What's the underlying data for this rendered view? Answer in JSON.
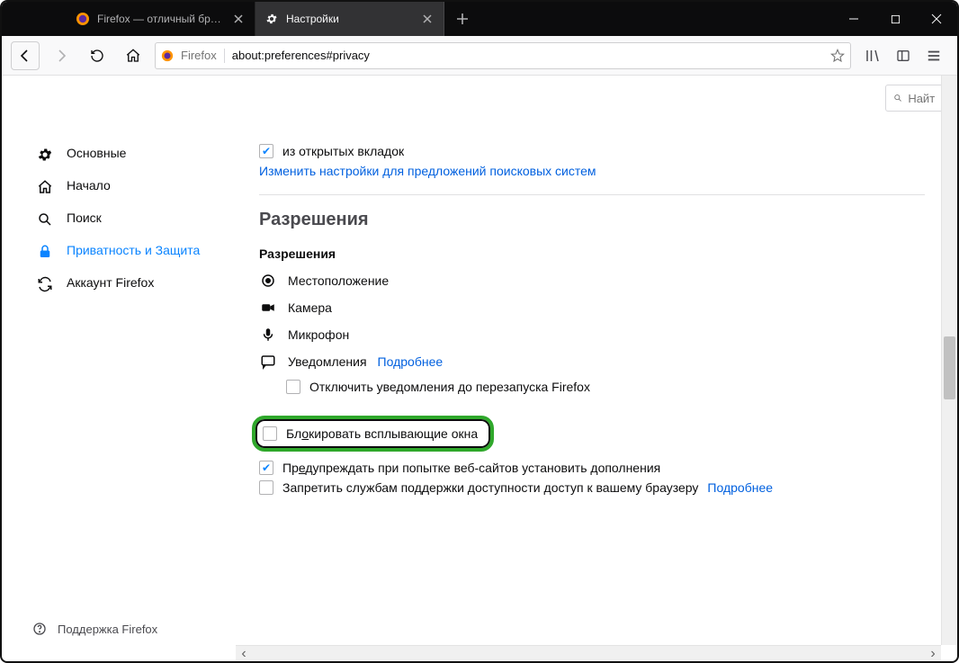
{
  "tabs": [
    {
      "label": "Firefox — отличный браузер д",
      "active": false
    },
    {
      "label": "Настройки",
      "active": true
    }
  ],
  "toolbar": {
    "origin_label": "Firefox",
    "url": "about:preferences#privacy"
  },
  "search": {
    "placeholder": "Найт"
  },
  "sidebar": {
    "items": [
      {
        "label": "Основные"
      },
      {
        "label": "Начало"
      },
      {
        "label": "Поиск"
      },
      {
        "label": "Приватность и Защита"
      },
      {
        "label": "Аккаунт Firefox"
      }
    ],
    "footer": "Поддержка Firefox"
  },
  "top": {
    "open_tabs_checkbox": "из открытых вкладок",
    "change_search_link": "Изменить настройки для предложений поисковых систем"
  },
  "permissions": {
    "heading": "Разрешения",
    "subheading": "Разрешения",
    "location": "Местоположение",
    "camera": "Камера",
    "microphone": "Микрофон",
    "notifications": "Уведомления",
    "learn_more": "Подробнее",
    "disable_notifications": "Отключить уведомления до перезапуска Firefox",
    "block_popups_pre": "Бл",
    "block_popups_u": "о",
    "block_popups_post": "кировать всплывающие окна",
    "warn_addons_pre": "Пр",
    "warn_addons_u": "е",
    "warn_addons_post": "дупреждать при попытке веб-сайтов установить дополнения",
    "deny_accessibility": "Запретить службам поддержки доступности доступ к вашему браузеру"
  }
}
